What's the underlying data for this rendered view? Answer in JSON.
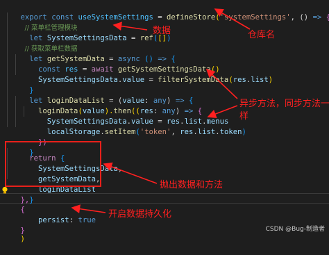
{
  "code": {
    "l1": {
      "t1": "export",
      "t2": " ",
      "t3": "const",
      "t4": " ",
      "t5": "useSystemSettings",
      "t6": " = ",
      "t7": "defineStore",
      "t8": "(",
      "t9": "'systemSettings'",
      "t10": ", () ",
      "t11": "=>",
      "t12": " {"
    },
    "l2": {
      "t1": "  // 菜单栏管理模块"
    },
    "l3": {
      "t1": "  ",
      "t2": "let",
      "t3": " ",
      "t4": "SystemSettingsData",
      "t5": " = ",
      "t6": "ref",
      "t7": "(",
      "t8": "[]",
      "t9": ")"
    },
    "l4": {
      "t1": "  // 获取菜单栏数据"
    },
    "l5": {
      "t1": "  ",
      "t2": "let",
      "t3": " ",
      "t4": "getSystemData",
      "t5": " = ",
      "t6": "async",
      "t7": " () ",
      "t8": "=>",
      "t9": " {"
    },
    "l6": {
      "t1": "    ",
      "t2": "const",
      "t3": " ",
      "t4": "res",
      "t5": " = ",
      "t6": "await",
      "t7": " ",
      "t8": "getSystemSettingsData",
      "t9": "()"
    },
    "l7": {
      "t1": "    ",
      "t2": "SystemSettingsData",
      "t3": ".",
      "t4": "value",
      "t5": " = ",
      "t6": "filterSystemData",
      "t7": "(",
      "t8": "res",
      "t9": ".",
      "t10": "list",
      "t11": ")"
    },
    "l8": {
      "t1": "  }"
    },
    "l9": {
      "t1": ""
    },
    "l10": {
      "t1": "  ",
      "t2": "let",
      "t3": " ",
      "t4": "loginDataList",
      "t5": " = (",
      "t6": "value",
      "t7": ": ",
      "t8": "any",
      "t9": ") ",
      "t10": "=>",
      "t11": " {"
    },
    "l11": {
      "t1": "    ",
      "t2": "loginData",
      "t3": "(",
      "t4": "value",
      "t5": ").",
      "t6": "then",
      "t7": "((",
      "t8": "res",
      "t9": ": ",
      "t10": "any",
      "t11": ") ",
      "t12": "=>",
      "t13": " {"
    },
    "l12": {
      "t1": "      ",
      "t2": "SystemSettingsData",
      "t3": ".",
      "t4": "value",
      "t5": " = ",
      "t6": "res",
      "t7": ".",
      "t8": "list",
      "t9": ".",
      "t10": "menus"
    },
    "l13": {
      "t1": "      ",
      "t2": "localStorage",
      "t3": ".",
      "t4": "setItem",
      "t5": "(",
      "t6": "'token'",
      "t7": ", ",
      "t8": "res",
      "t9": ".",
      "t10": "list",
      "t11": ".",
      "t12": "token",
      "t13": ")"
    },
    "l14": {
      "t1": "    })"
    },
    "l15": {
      "t1": "  }"
    },
    "l16": {
      "t1": ""
    },
    "l17": {
      "t1": "  ",
      "t2": "return",
      "t3": " {"
    },
    "l18": {
      "t1": "    ",
      "t2": "SystemSettingsData",
      "t3": ","
    },
    "l19": {
      "t1": "    ",
      "t2": "getSystemData",
      "t3": ","
    },
    "l20": {
      "t1": "    ",
      "t2": "loginDataList"
    },
    "l21": {
      "t1": "  }"
    },
    "l22": {
      "t1": "},"
    },
    "l23": {
      "t1": "{"
    },
    "l24": {
      "t1": "    ",
      "t2": "persist",
      "t3": ": ",
      "t4": "true"
    },
    "l25": {
      "t1": "}"
    },
    "l26": {
      "t1": ")"
    }
  },
  "annotations": {
    "data": "数据",
    "store_name": "仓库名",
    "async_method": "异步方法，同步方法一\n样",
    "expose": "抛出数据和方法",
    "persist": "开启数据持久化"
  },
  "watermark": "CSDN @Bug-制造者",
  "colors": {
    "annotation": "#ff2020",
    "editor_background": "#1e1e1e"
  }
}
